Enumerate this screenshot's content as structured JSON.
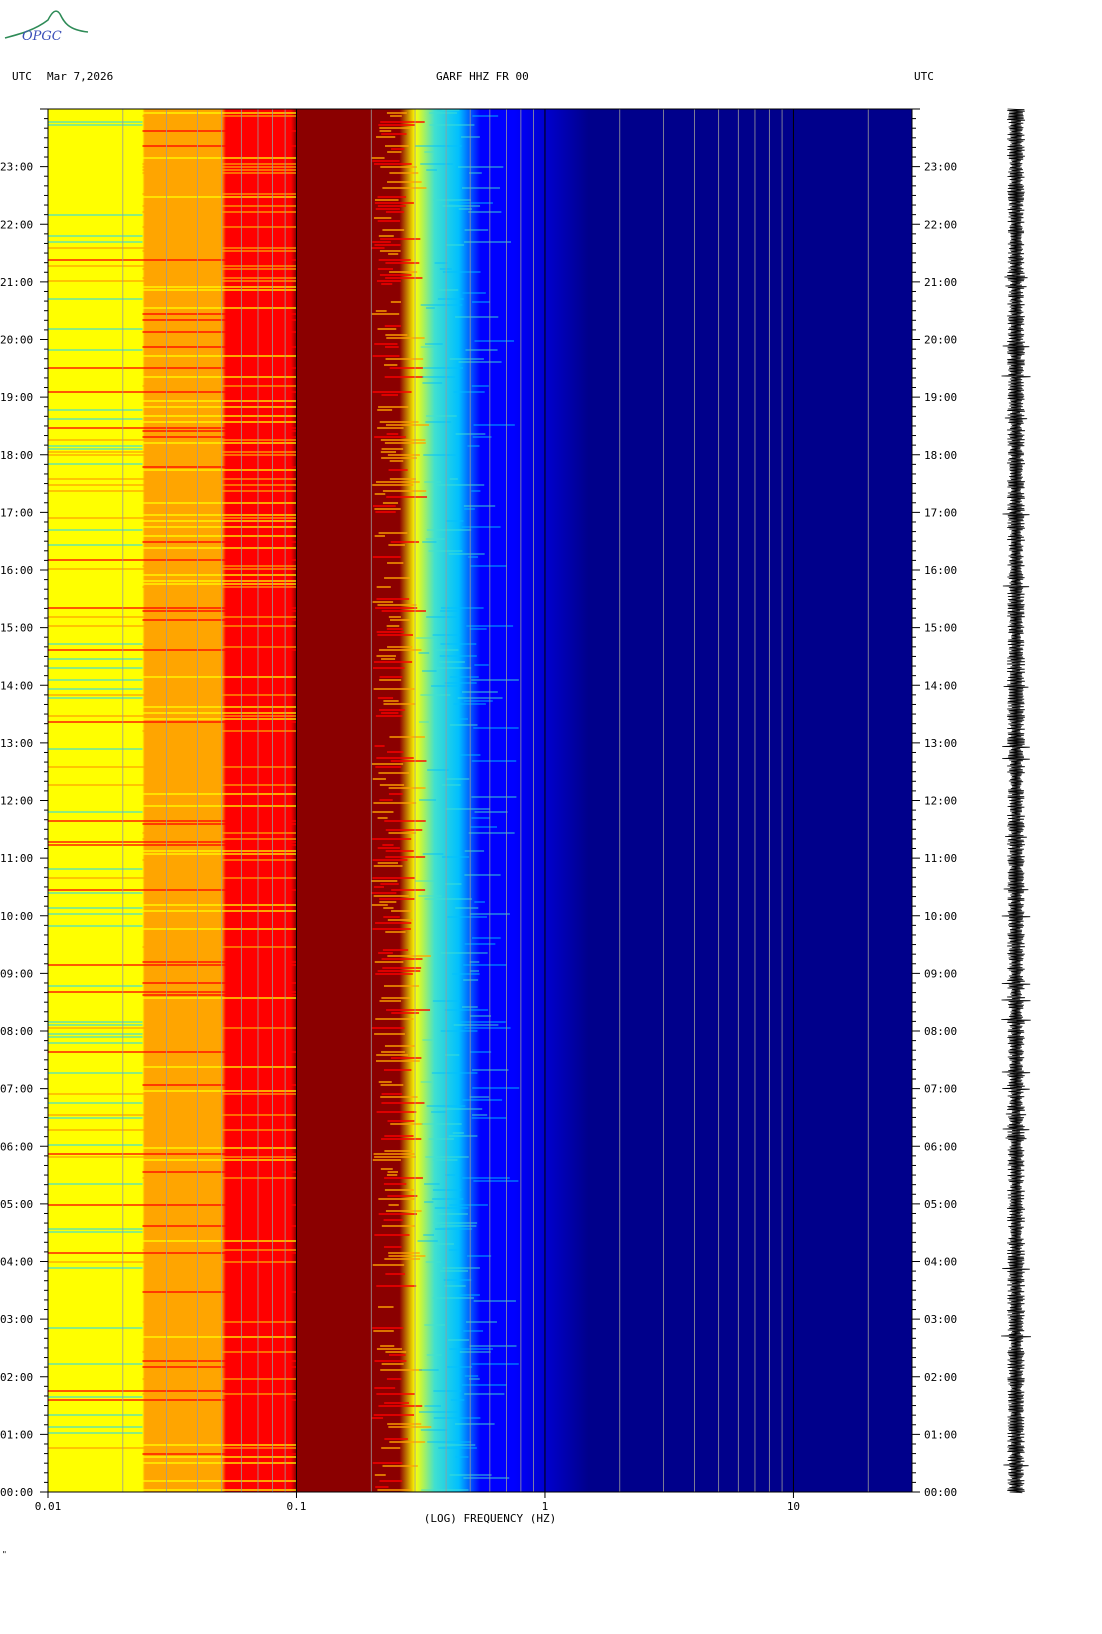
{
  "header": {
    "left_tz": "UTC",
    "date": "Mar 7,2026",
    "station": "GARF HHZ FR 00",
    "right_tz": "UTC"
  },
  "logo": {
    "text": "OPGC"
  },
  "corner_mark": "\"",
  "chart_data": {
    "type": "heatmap",
    "title": "GARF HHZ FR 00",
    "xlabel": "(LOG) FREQUENCY (HZ)",
    "ylabel": "",
    "x_scale": "log",
    "xlim": [
      0.01,
      30
    ],
    "ylim": [
      0,
      24
    ],
    "x_tick_labels": [
      {
        "value": 0.01,
        "label": "0.01"
      },
      {
        "value": 0.1,
        "label": "0.1"
      },
      {
        "value": 1,
        "label": "1"
      },
      {
        "value": 10,
        "label": "10"
      }
    ],
    "y_tick_labels": [
      "00:00",
      "01:00",
      "02:00",
      "03:00",
      "04:00",
      "05:00",
      "06:00",
      "07:00",
      "08:00",
      "09:00",
      "10:00",
      "11:00",
      "12:00",
      "13:00",
      "14:00",
      "15:00",
      "16:00",
      "17:00",
      "18:00",
      "19:00",
      "20:00",
      "21:00",
      "22:00",
      "23:00"
    ],
    "y_unit": "hours UTC",
    "colormap": [
      "#00008b",
      "#0000ff",
      "#00bfff",
      "#40e0d0",
      "#ffff00",
      "#ffa500",
      "#ff0000",
      "#8b0000"
    ],
    "dominant_band_hz": [
      0.1,
      0.28
    ],
    "gridlines": "vertical, at log frequency subdivisions",
    "side_panel": "seismogram trace (24 h)"
  }
}
